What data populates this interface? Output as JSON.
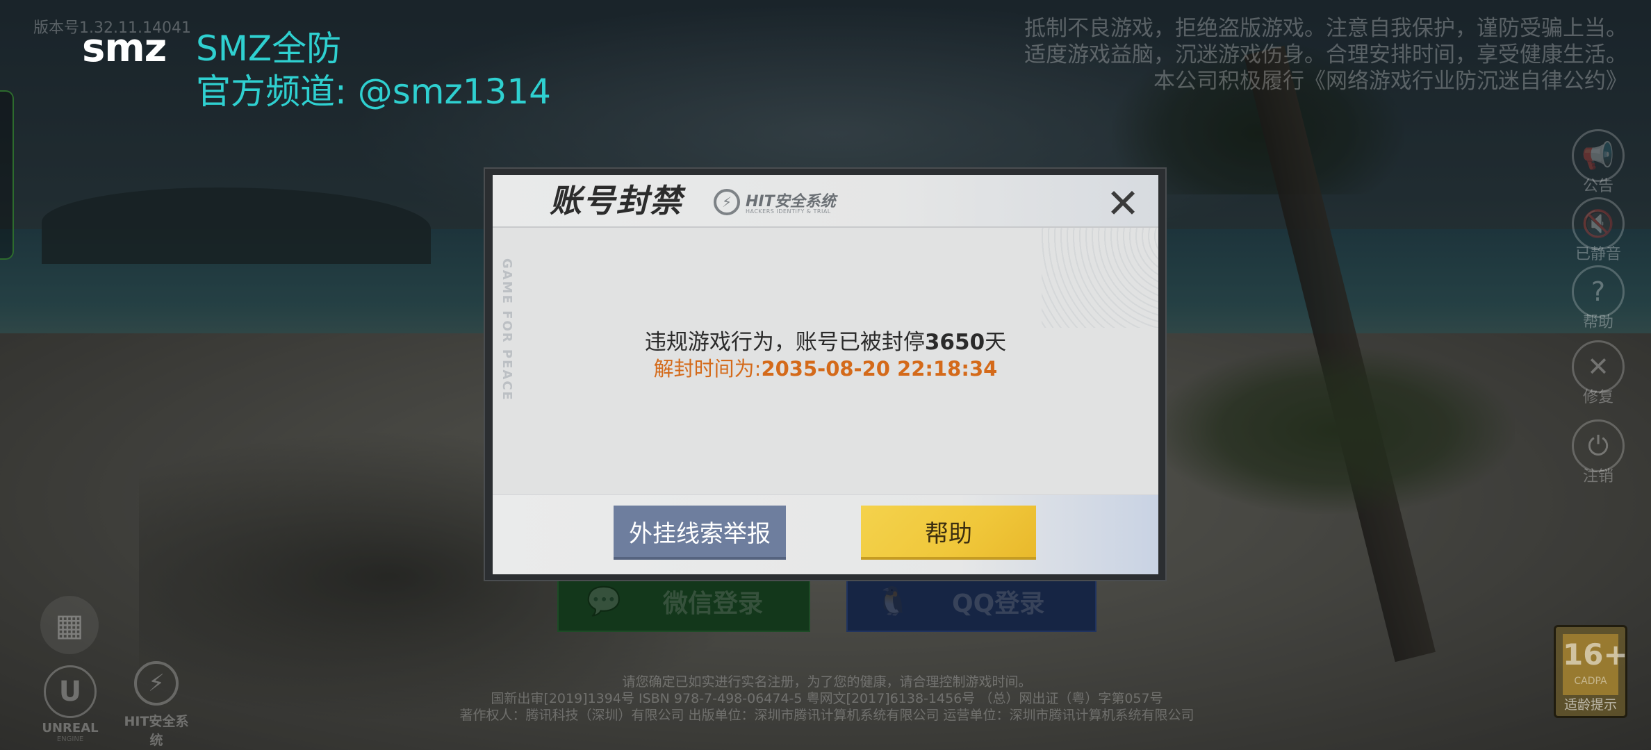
{
  "top_left": {
    "version": "版本号1.32.11.14041"
  },
  "watermark": {
    "logo": "smz",
    "line1": "SMZ全防",
    "line2": "官方频道: @smz1314"
  },
  "notice": [
    "抵制不良游戏，拒绝盗版游戏。注意自我保护，谨防受骗上当。",
    "适度游戏益脑，沉迷游戏伤身。合理安排时间，享受健康生活。",
    "本公司积极履行《网络游戏行业防沉迷自律公约》"
  ],
  "side_buttons": [
    {
      "icon": "megaphone-icon",
      "glyph": "📢",
      "label": "公告"
    },
    {
      "icon": "speaker-muted-icon",
      "glyph": "🔇",
      "label": "已静音"
    },
    {
      "icon": "question-icon",
      "glyph": "?",
      "label": "帮助"
    },
    {
      "icon": "wrench-icon",
      "glyph": "✕",
      "label": "修复"
    },
    {
      "icon": "power-icon",
      "glyph": "⏻",
      "label": "注销"
    }
  ],
  "login": {
    "wechat_label": "微信登录",
    "qq_label": "QQ登录"
  },
  "bottom_left": {
    "unreal_text": "UNREAL",
    "unreal_sub": "ENGINE",
    "hit_text": "HIT安全系统"
  },
  "legal": [
    "请您确定已如实进行实名注册，为了您的健康，请合理控制游戏时间。",
    "国新出审[2019]1394号  ISBN 978-7-498-06474-5  粤网文[2017]6138-1456号  （总）网出证（粤）字第057号",
    "著作权人：腾讯科技（深圳）有限公司   出版单位：深圳市腾讯计算机系统有限公司   运营单位：深圳市腾讯计算机系统有限公司"
  ],
  "age_rating": {
    "number": "16+",
    "org": "CADPA",
    "label": "适龄提示"
  },
  "dialog": {
    "title": "账号封禁",
    "system_name": "HIT安全系统",
    "system_sub": "HACKERS IDENTIFY & TRIAL",
    "side_text": "GAME FOR PEACE",
    "message_prefix": "违规游戏行为，账号已被封停",
    "days": "3650",
    "days_suffix": "天",
    "unban_prefix": "解封时间为:",
    "unban_time": "2035-08-20 22:18:34",
    "report_button": "外挂线索举报",
    "help_button": "帮助",
    "close_glyph": "✕"
  },
  "colors": {
    "watermark": "#2fd0d0",
    "unban_time": "#d46a1a",
    "report_button": "#6e7e9e",
    "help_button": "#f0c73a"
  }
}
